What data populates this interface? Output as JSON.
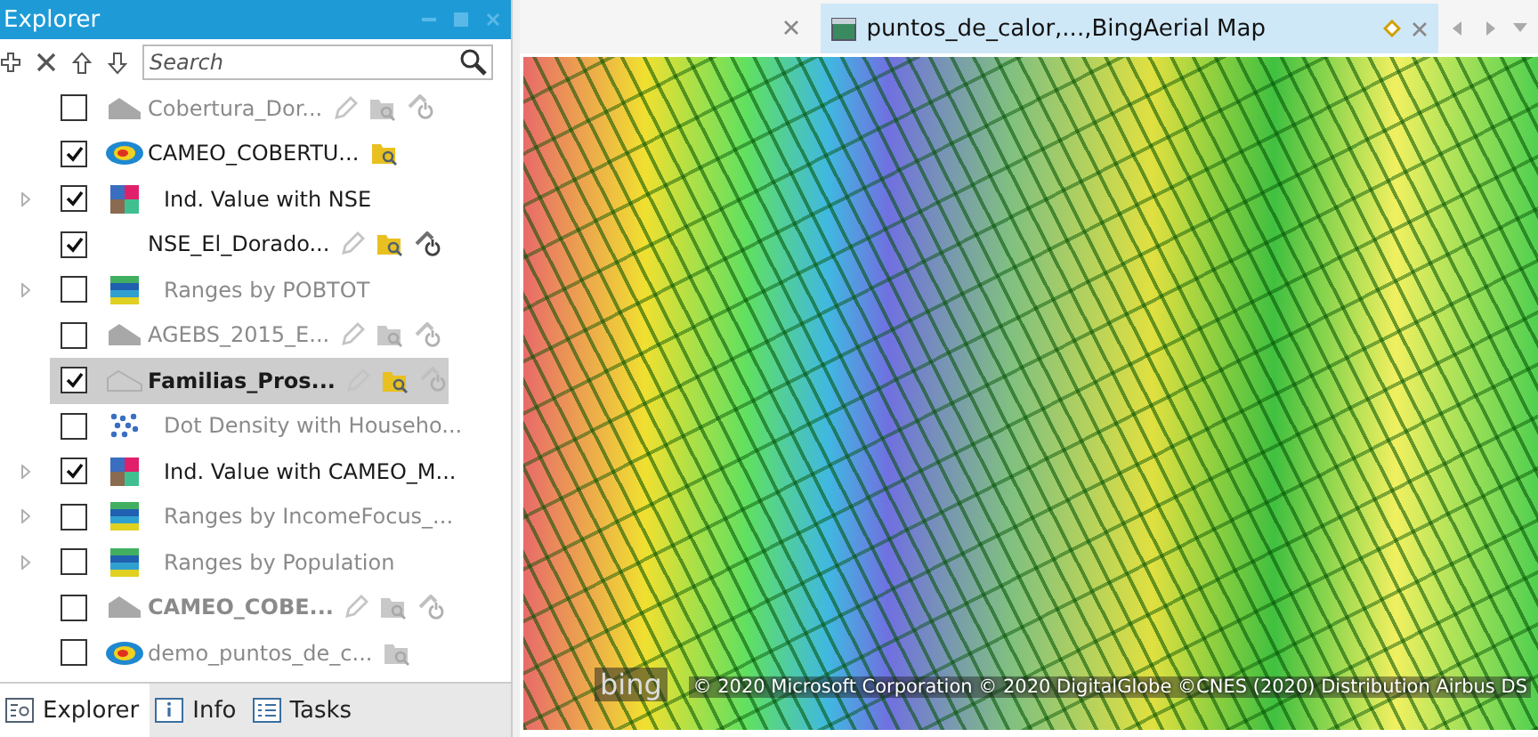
{
  "explorer": {
    "title": "Explorer",
    "search": {
      "placeholder": "Search"
    },
    "layers": [
      {
        "label": "Cobertura_Dor...",
        "kind": "layer",
        "expandable": false,
        "checked": false,
        "dimmed": true,
        "bold": false,
        "selected": false,
        "tools": [
          {
            "kind": "edit",
            "enabled": false
          },
          {
            "kind": "query",
            "enabled": false
          },
          {
            "kind": "power",
            "enabled": false
          }
        ]
      },
      {
        "label": "CAMEO_COBERTU...",
        "kind": "layer",
        "expandable": false,
        "checked": true,
        "dimmed": false,
        "bold": false,
        "selected": false,
        "tools": [
          {
            "kind": "query",
            "enabled": true
          }
        ]
      },
      {
        "label": "Ind. Value with NSE",
        "kind": "renderer",
        "expandable": true,
        "checked": true,
        "dimmed": false,
        "bold": false,
        "selected": false
      },
      {
        "label": "NSE_El_Dorado...",
        "kind": "layer",
        "expandable": false,
        "checked": true,
        "dimmed": false,
        "bold": false,
        "selected": false,
        "tools": [
          {
            "kind": "edit",
            "enabled": false
          },
          {
            "kind": "query",
            "enabled": true
          },
          {
            "kind": "power",
            "enabled": true
          }
        ]
      },
      {
        "label": "Ranges by POBTOT",
        "kind": "renderer",
        "expandable": true,
        "checked": false,
        "dimmed": true,
        "bold": false,
        "selected": false
      },
      {
        "label": "AGEBS_2015_E...",
        "kind": "layer",
        "expandable": false,
        "checked": false,
        "dimmed": true,
        "bold": false,
        "selected": false,
        "tools": [
          {
            "kind": "edit",
            "enabled": false
          },
          {
            "kind": "query",
            "enabled": false
          },
          {
            "kind": "power",
            "enabled": false
          }
        ]
      },
      {
        "label": "Familias_Pros...",
        "kind": "layer",
        "expandable": false,
        "checked": true,
        "dimmed": false,
        "bold": true,
        "selected": true,
        "tools": [
          {
            "kind": "edit",
            "enabled": false
          },
          {
            "kind": "query",
            "enabled": true
          },
          {
            "kind": "power",
            "enabled": false
          }
        ]
      },
      {
        "label": "Dot Density with Househo...",
        "kind": "renderer",
        "expandable": false,
        "checked": false,
        "dimmed": true,
        "bold": false,
        "selected": false
      },
      {
        "label": "Ind. Value with CAMEO_M...",
        "kind": "renderer",
        "expandable": true,
        "checked": true,
        "dimmed": false,
        "bold": false,
        "selected": false
      },
      {
        "label": "Ranges by IncomeFocus_...",
        "kind": "renderer",
        "expandable": true,
        "checked": false,
        "dimmed": true,
        "bold": false,
        "selected": false
      },
      {
        "label": "Ranges by Population",
        "kind": "renderer",
        "expandable": true,
        "checked": false,
        "dimmed": true,
        "bold": false,
        "selected": false
      },
      {
        "label": "CAMEO_COBE...",
        "kind": "layer",
        "expandable": false,
        "checked": false,
        "dimmed": true,
        "bold": true,
        "selected": false,
        "tools": [
          {
            "kind": "edit",
            "enabled": false
          },
          {
            "kind": "query",
            "enabled": false
          },
          {
            "kind": "power",
            "enabled": false
          }
        ]
      },
      {
        "label": "demo_puntos_de_c...",
        "kind": "layer",
        "expandable": false,
        "checked": false,
        "dimmed": true,
        "bold": false,
        "selected": false,
        "tools": [
          {
            "kind": "query",
            "enabled": false
          }
        ]
      }
    ],
    "bottom_tabs": [
      {
        "label": "Explorer",
        "selected": true
      },
      {
        "label": "Info",
        "selected": false
      },
      {
        "label": "Tasks",
        "selected": false
      }
    ]
  },
  "map": {
    "tabs": [
      {
        "label": "puntos_de_calor,...,BingAerial Map",
        "selected": true
      }
    ],
    "copyright": "© 2020 Microsoft Corporation © 2020 DigitalGlobe ©CNES (2020) Distribution Airbus DS",
    "logo": "bing"
  }
}
